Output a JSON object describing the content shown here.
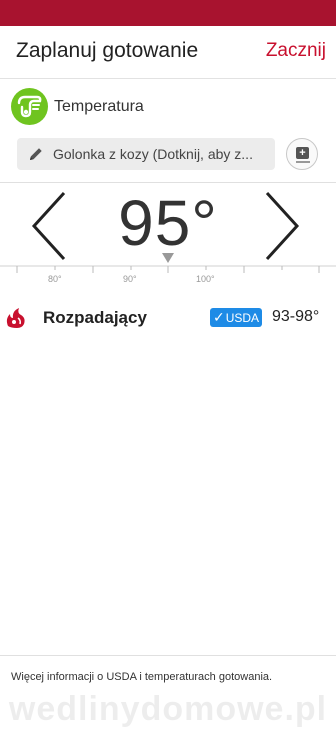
{
  "header": {
    "title": "Zaplanuj gotowanie",
    "start_label": "Zacznij"
  },
  "temperature_row": {
    "label": "Temperatura",
    "icon": "thermometer-icon"
  },
  "name_field": {
    "text": "Golonka z kozy (Dotknij, aby z...",
    "icon": "pencil-icon"
  },
  "add_button": {
    "icon": "add-note-icon"
  },
  "selector": {
    "value": "95°",
    "ruler_labels": [
      "80°",
      "90°",
      "100°"
    ]
  },
  "doneness": {
    "label": "Rozpadający",
    "badge": "USDA",
    "range": "93-98°",
    "icon": "flame-meat-icon"
  },
  "footer": {
    "info_text": "Więcej informacji o USDA i temperaturach gotowania."
  },
  "watermark": "wedlinydomowe.pl",
  "colors": {
    "status_bar": "#a8132f",
    "accent": "#c8102e",
    "icon_green": "#6fc41f",
    "usda_blue": "#1e8be6"
  }
}
